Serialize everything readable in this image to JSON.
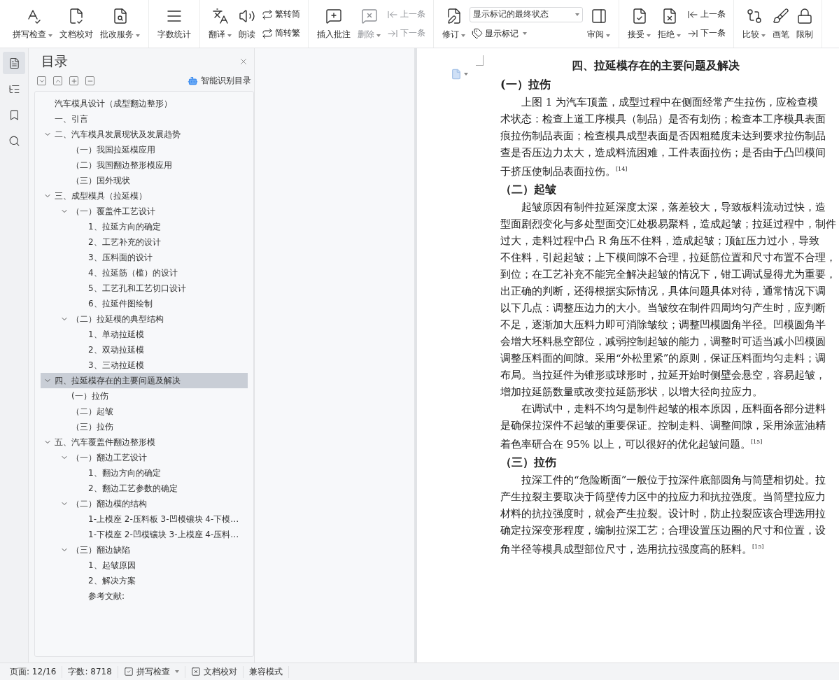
{
  "toolbar": {
    "groups": [
      {
        "items": [
          {
            "kind": "large",
            "label": "拼写检查",
            "caret": true,
            "disabled": false
          },
          {
            "kind": "large",
            "label": "文档校对",
            "caret": false,
            "disabled": false
          },
          {
            "kind": "large",
            "label": "批改服务",
            "caret": true,
            "disabled": false
          }
        ]
      },
      {
        "items": [
          {
            "kind": "large",
            "label": "字数统计",
            "caret": false,
            "disabled": false
          }
        ]
      },
      {
        "items": [
          {
            "kind": "large",
            "label": "翻译",
            "caret": true,
            "disabled": false
          },
          {
            "kind": "large",
            "label": "朗读",
            "caret": false,
            "disabled": false
          },
          {
            "kind": "stack",
            "rows": [
              {
                "kind": "small",
                "label": "繁转简",
                "caret": false,
                "disabled": false
              },
              {
                "kind": "small",
                "label": "简转繁",
                "caret": false,
                "disabled": false
              }
            ]
          }
        ]
      },
      {
        "items": [
          {
            "kind": "large",
            "label": "插入批注",
            "caret": false,
            "disabled": false
          },
          {
            "kind": "large",
            "label": "删除",
            "caret": true,
            "disabled": true
          },
          {
            "kind": "stack",
            "rows": [
              {
                "kind": "small",
                "label": "上一条",
                "caret": false,
                "disabled": true
              },
              {
                "kind": "small",
                "label": "下一条",
                "caret": false,
                "disabled": true
              }
            ]
          }
        ]
      },
      {
        "items": [
          {
            "kind": "large",
            "label": "修订",
            "caret": true,
            "disabled": false
          },
          {
            "kind": "stack",
            "rows": [
              {
                "kind": "select",
                "label": "显示标记的最终状态",
                "caret": true
              },
              {
                "kind": "small",
                "label": "显示标记",
                "caret": true,
                "disabled": false
              }
            ]
          },
          {
            "kind": "large",
            "label": "审阅",
            "caret": true,
            "disabled": false
          }
        ]
      },
      {
        "items": [
          {
            "kind": "large",
            "label": "接受",
            "caret": true,
            "disabled": false
          },
          {
            "kind": "large",
            "label": "拒绝",
            "caret": true,
            "disabled": false
          },
          {
            "kind": "stack",
            "rows": [
              {
                "kind": "small",
                "label": "上一条",
                "caret": false,
                "disabled": false
              },
              {
                "kind": "small",
                "label": "下一条",
                "caret": false,
                "disabled": false
              }
            ]
          }
        ]
      },
      {
        "items": [
          {
            "kind": "large",
            "label": "比较",
            "caret": true,
            "disabled": false
          },
          {
            "kind": "large",
            "label": "画笔",
            "caret": false,
            "disabled": false
          },
          {
            "kind": "large",
            "label": "限制",
            "caret": false,
            "disabled": false
          }
        ]
      }
    ]
  },
  "rail_tabs": [
    {
      "selected": true
    },
    {
      "selected": false
    },
    {
      "selected": false
    },
    {
      "selected": false
    }
  ],
  "toc": {
    "title": "目录",
    "smart_button": "智能识别目录",
    "items": [
      {
        "label": "汽车模具设计（成型翻边整形）",
        "selected": false
      },
      {
        "label": "一、引言",
        "selected": false
      },
      {
        "label": "二、汽车模具发展现状及发展趋势",
        "selected": false,
        "expanded": true,
        "children": [
          {
            "label": "（一）我国拉延模应用",
            "selected": false
          },
          {
            "label": "（二）我国翻边整形模应用",
            "selected": false
          },
          {
            "label": "（三）国外现状",
            "selected": false
          }
        ]
      },
      {
        "label": "三、成型模具（拉延模）",
        "selected": false,
        "expanded": true,
        "children": [
          {
            "label": "（一）覆盖件工艺设计",
            "selected": false,
            "expanded": true,
            "children": [
              {
                "label": "1、拉延方向的确定",
                "selected": false
              },
              {
                "label": "2、工艺补充的设计",
                "selected": false
              },
              {
                "label": "3、压料面的设计",
                "selected": false
              },
              {
                "label": "4、拉延筋（槛）的设计",
                "selected": false
              },
              {
                "label": "5、工艺孔和工艺切口设计",
                "selected": false
              },
              {
                "label": "6、拉延件图绘制",
                "selected": false
              }
            ]
          },
          {
            "label": "（二）拉延模的典型结构",
            "selected": false,
            "expanded": true,
            "children": [
              {
                "label": "1、单动拉延模",
                "selected": false
              },
              {
                "label": "2、双动拉延模",
                "selected": false
              },
              {
                "label": "3、三动拉延模",
                "selected": false
              }
            ]
          }
        ]
      },
      {
        "label": "四、拉延模存在的主要问题及解决",
        "selected": true,
        "expanded": true,
        "children": [
          {
            "label": "(一）拉伤",
            "selected": false
          },
          {
            "label": "（二）起皱",
            "selected": false
          },
          {
            "label": "（三）拉伤",
            "selected": false
          }
        ]
      },
      {
        "label": "五、汽车覆盖件翻边整形模",
        "selected": false,
        "expanded": true,
        "children": [
          {
            "label": "（一）翻边工艺设计",
            "selected": false,
            "expanded": true,
            "children": [
              {
                "label": "1、翻边方向的确定",
                "selected": false
              },
              {
                "label": "2、翻边工艺参数的确定",
                "selected": false
              }
            ]
          },
          {
            "label": "（二）翻边模的结构",
            "selected": false,
            "expanded": true,
            "children": [
              {
                "label": "1-上模座 2-压料板 3-凹模镶块 4-下模…",
                "selected": false
              },
              {
                "label": "1-下模座 2-凹模镶块 3-上模座 4-压料…",
                "selected": false
              }
            ]
          },
          {
            "label": "（三）翻边缺陷",
            "selected": false,
            "expanded": true,
            "children": [
              {
                "label": "1、起皱原因",
                "selected": false
              },
              {
                "label": "2、解决方案",
                "selected": false
              },
              {
                "label": "参考文献:",
                "selected": false
              }
            ]
          }
        ]
      }
    ]
  },
  "document": {
    "blocks": [
      {
        "kind": "title",
        "text": "四、拉延模存在的主要问题及解决"
      },
      {
        "kind": "heading",
        "text": "(一）拉伤"
      },
      {
        "kind": "para",
        "lines": [
          "上图 1 为汽车顶盖，成型过程中在侧面经常产生拉伤，应检查模",
          "术状态：检查上道工序模具（制品）是否有划伤；检查本工序模具表面",
          "痕拉伤制品表面；检查模具成型表面是否因粗糙度未达到要求拉伤制品",
          "查是否压边力太大，造成料流困难，工件表面拉伤；是否由于凸凹模间",
          "于挤压使制品表面拉伤。$^{[14]}$"
        ]
      },
      {
        "kind": "heading",
        "text": "（二）起皱"
      },
      {
        "kind": "para",
        "lines": [
          "起皱原因有制件拉延深度太深，落差较大，导致板料流动过快，造",
          "型面剧烈变化与多处型面交汇处极易聚料，造成起皱；拉延过程中，制件",
          "过大，走料过程中凸 R 角压不住料，造成起皱；顶缸压力过小，导致",
          "不住料，引起起皱；上下模间隙不合理，拉延筋位置和尺寸布置不合理，",
          "到位；在工艺补充不能完全解决起皱的情况下，钳工调试显得尤为重要，",
          "出正确的判断，还得根据实际情况，具体问题具体对待，通常情况下调",
          "以下几点：调整压边力的大小。当皱纹在制件四周均匀产生时，应判断",
          "不足，逐渐加大压料力即可消除皱纹；调整凹模圆角半径。凹模圆角半",
          "会增大坯料悬空部位，减弱控制起皱的能力，调整时可适当减小凹模圆",
          "调整压料面的间隙。采用“外松里紧”的原则，保证压料面均匀走料；调",
          "布局。当拉延件为锥形或球形时，拉延开始时侧壁会悬空，容易起皱，",
          "增加拉延筋数量或改变拉延筋形状，以增大径向拉应力。"
        ]
      },
      {
        "kind": "para",
        "lines": [
          "在调试中，走料不均匀是制件起皱的根本原因，压料面各部分进料",
          "是确保拉深件不起皱的重要保证。控制走料、调整间隙，采用涂蓝油精",
          "着色率研合在 95% 以上，可以很好的优化起皱问题。$^{[15]}$"
        ]
      },
      {
        "kind": "heading",
        "text": "（三）拉伤"
      },
      {
        "kind": "para",
        "lines": [
          "拉深工件的“危险断面”一般位于拉深件底部圆角与筒壁相切处。拉",
          "产生拉裂主要取决于筒壁传力区中的拉应力和抗拉强度。当筒壁拉应力",
          "材料的抗拉强度时，就会产生拉裂。设计时，防止拉裂应该合理选用拉",
          "确定拉深变形程度，编制拉深工艺；合理设置压边圈的尺寸和位置，设",
          "角半径等模具成型部位尺寸，选用抗拉强度高的胚料。$^{[15]}$"
        ]
      }
    ]
  },
  "status_bar": [
    {
      "kind": "text",
      "label": "页面: 12/16"
    },
    {
      "kind": "text",
      "label": "字数: 8718"
    },
    {
      "kind": "check",
      "label": "拼写检查",
      "caret": true
    },
    {
      "kind": "proof",
      "label": "文档校对"
    },
    {
      "kind": "text",
      "label": "兼容模式"
    }
  ]
}
